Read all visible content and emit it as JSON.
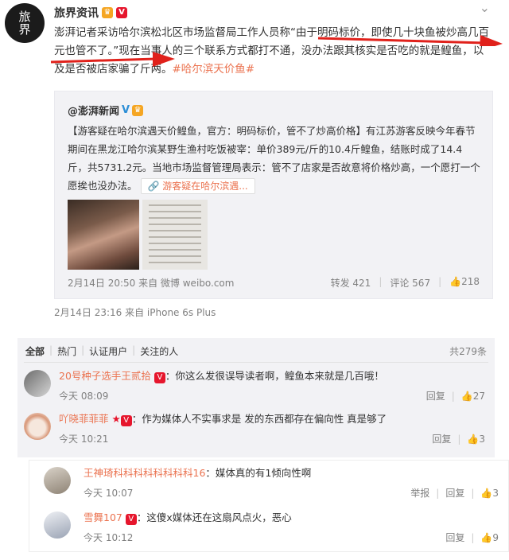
{
  "post": {
    "avatar_text_1": "旅",
    "avatar_text_2": "界",
    "author": "旅界资讯",
    "text_main": "澎湃记者采访哈尔滨松北区市场监督局工作人员称“由于明码标价，即使几十块鱼被炒高几百元也管不了。”现在当事人的三个联系方式都打不通，没办法跟其核实是否吃的就是鳇鱼，以及是否被店家骗了斤两。",
    "tag": "#哈尔滨天价鱼#",
    "time": "2月14日 23:16 来自 iPhone 6s Plus"
  },
  "quote": {
    "author": "@澎湃新闻",
    "text": "【游客疑在哈尔滨遇天价鳇鱼，官方：明码标价，管不了炒高价格】有江苏游客反映今年春节期间在黑龙江哈尔滨某野生渔村吃饭被宰：单价389元/斤的10.4斤鳇鱼，结账时成了14.4斤，共5731.2元。当地市场监督管理局表示：管不了店家是否故意将价格炒高，一个愿打一个愿挨也没办法。",
    "link": "游客疑在哈尔滨遇...",
    "time": "2月14日 20:50 来自 微博 weibo.com",
    "repost": "转发 421",
    "comment": "评论 567",
    "likes": "218"
  },
  "comments": {
    "tabs": [
      "全部",
      "热门",
      "认证用户",
      "关注的人"
    ],
    "total": "共279条",
    "items": [
      {
        "name": "20号种子选手王贰拾",
        "text": "：你这么发很误导读者啊，鳇鱼本来就是几百哦！",
        "time": "今天 08:09",
        "reply": "回复",
        "likes": "27"
      },
      {
        "name": "吖晓菲菲菲",
        "text": "：作为媒体人不实事求是 发的东西都存在偏向性 真是够了",
        "time": "今天 10:21",
        "reply": "回复",
        "likes": "3"
      }
    ],
    "sub_items": [
      {
        "name": "王神琦科科科科科科科科16",
        "text": "：媒体真的有1倾向性啊",
        "time": "今天 10:07",
        "report": "举报",
        "reply": "回复",
        "likes": "3"
      },
      {
        "name": "雪舞107",
        "text": "：这傻x媒体还在这扇风点火，恶心",
        "time": "今天 10:12",
        "reply": "回复",
        "likes": "9"
      }
    ]
  },
  "colors": {
    "accent": "#eb7350",
    "annotation_red": "#e0211b",
    "verified_blue": "#2c8ed6"
  }
}
